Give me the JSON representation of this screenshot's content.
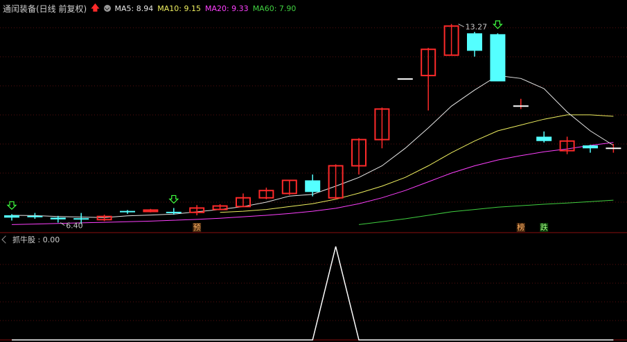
{
  "header": {
    "title": "通闰装备(日线 前复权)",
    "ma5_label": "MA5: 8.94",
    "ma10_label": "MA10: 9.15",
    "ma20_label": "MA20: 9.33",
    "ma60_label": "MA60: 7.90"
  },
  "colors": {
    "ma5": "#e8e8e8",
    "ma10": "#f0f060",
    "ma20": "#ff40ff",
    "ma60": "#40d040",
    "up": "#ff2a2a",
    "down": "#54ffff",
    "indicator": "#ffffff"
  },
  "sub_header": {
    "label": "抓牛股 : 0.00"
  },
  "chart_data": [
    {
      "type": "candlestick",
      "annotations": {
        "high_label": "13.27",
        "low_label": "6.40",
        "markers": [
          {
            "text": "预",
            "index": 8
          },
          {
            "text": "榜",
            "index": 22
          },
          {
            "text": "跌",
            "index": 23
          }
        ]
      },
      "candles": [
        {
          "o": 6.7,
          "c": 6.62,
          "h": 6.74,
          "l": 6.52
        },
        {
          "o": 6.68,
          "c": 6.64,
          "h": 6.78,
          "l": 6.58
        },
        {
          "o": 6.62,
          "c": 6.56,
          "h": 6.68,
          "l": 6.45
        },
        {
          "o": 6.6,
          "c": 6.58,
          "h": 6.78,
          "l": 6.4
        },
        {
          "o": 6.55,
          "c": 6.66,
          "h": 6.72,
          "l": 6.5
        },
        {
          "o": 6.85,
          "c": 6.83,
          "h": 6.88,
          "l": 6.75
        },
        {
          "o": 6.83,
          "c": 6.88,
          "h": 6.92,
          "l": 6.8
        },
        {
          "o": 6.82,
          "c": 6.78,
          "h": 6.95,
          "l": 6.72
        },
        {
          "o": 6.8,
          "c": 6.95,
          "h": 7.05,
          "l": 6.7
        },
        {
          "o": 6.9,
          "c": 7.02,
          "h": 7.08,
          "l": 6.88
        },
        {
          "o": 7.0,
          "c": 7.3,
          "h": 7.45,
          "l": 6.98
        },
        {
          "o": 7.3,
          "c": 7.55,
          "h": 7.65,
          "l": 7.25
        },
        {
          "o": 7.45,
          "c": 7.9,
          "h": 7.92,
          "l": 7.4
        },
        {
          "o": 7.9,
          "c": 7.5,
          "h": 8.1,
          "l": 7.35
        },
        {
          "o": 7.3,
          "c": 8.4,
          "h": 8.45,
          "l": 7.25
        },
        {
          "o": 8.4,
          "c": 9.3,
          "h": 9.35,
          "l": 8.1
        },
        {
          "o": 9.3,
          "c": 10.35,
          "h": 10.4,
          "l": 9.0
        },
        {
          "o": 11.38,
          "c": 11.38,
          "h": 11.38,
          "l": 11.38
        },
        {
          "o": 11.5,
          "c": 12.4,
          "h": 12.45,
          "l": 10.3
        },
        {
          "o": 12.2,
          "c": 13.2,
          "h": 13.27,
          "l": 12.2
        },
        {
          "o": 12.95,
          "c": 12.35,
          "h": 13.0,
          "l": 12.15
        },
        {
          "o": 12.92,
          "c": 11.3,
          "h": 12.95,
          "l": 11.3
        },
        {
          "o": 10.45,
          "c": 10.45,
          "h": 10.7,
          "l": 10.35
        },
        {
          "o": 9.4,
          "c": 9.25,
          "h": 9.58,
          "l": 9.2
        },
        {
          "o": 8.92,
          "c": 9.25,
          "h": 9.4,
          "l": 8.8
        },
        {
          "o": 9.1,
          "c": 9.0,
          "h": 9.12,
          "l": 8.85
        },
        {
          "o": 9.0,
          "c": 9.0,
          "h": 9.15,
          "l": 8.85
        }
      ],
      "ma": {
        "ma5": [
          6.7,
          6.69,
          6.66,
          6.64,
          6.62,
          6.68,
          6.71,
          6.74,
          6.82,
          6.9,
          7.0,
          7.15,
          7.36,
          7.42,
          7.7,
          8.0,
          8.4,
          9.0,
          9.7,
          10.45,
          11.0,
          11.5,
          11.4,
          11.05,
          10.25,
          9.6,
          9.1
        ],
        "ma10": [
          null,
          null,
          null,
          null,
          null,
          null,
          null,
          null,
          null,
          6.8,
          6.84,
          6.9,
          7.0,
          7.1,
          7.25,
          7.46,
          7.7,
          8.0,
          8.4,
          8.85,
          9.25,
          9.6,
          9.8,
          10.0,
          10.15,
          10.15,
          10.1
        ],
        "ma20": [
          6.38,
          6.4,
          6.42,
          6.44,
          6.46,
          6.48,
          6.5,
          6.53,
          6.56,
          6.6,
          6.65,
          6.7,
          6.76,
          6.84,
          6.94,
          7.1,
          7.3,
          7.55,
          7.85,
          8.15,
          8.4,
          8.6,
          8.75,
          8.88,
          8.98,
          9.1,
          9.2
        ],
        "ma60": [
          null,
          null,
          null,
          null,
          null,
          null,
          null,
          null,
          null,
          null,
          null,
          null,
          null,
          null,
          null,
          6.38,
          6.48,
          6.58,
          6.7,
          6.82,
          6.9,
          6.98,
          7.03,
          7.08,
          7.12,
          7.17,
          7.22
        ]
      },
      "ylim": [
        6.2,
        13.5
      ],
      "down_signal_indices": [
        0,
        7,
        21
      ]
    },
    {
      "type": "line",
      "name": "抓牛股",
      "values": [
        0,
        0,
        0,
        0,
        0,
        0,
        0,
        0,
        0,
        0,
        0,
        0,
        0,
        0,
        1,
        0,
        0,
        0,
        0,
        0,
        0,
        0,
        0,
        0,
        0,
        0,
        0
      ],
      "ylim": [
        0,
        1
      ]
    }
  ]
}
